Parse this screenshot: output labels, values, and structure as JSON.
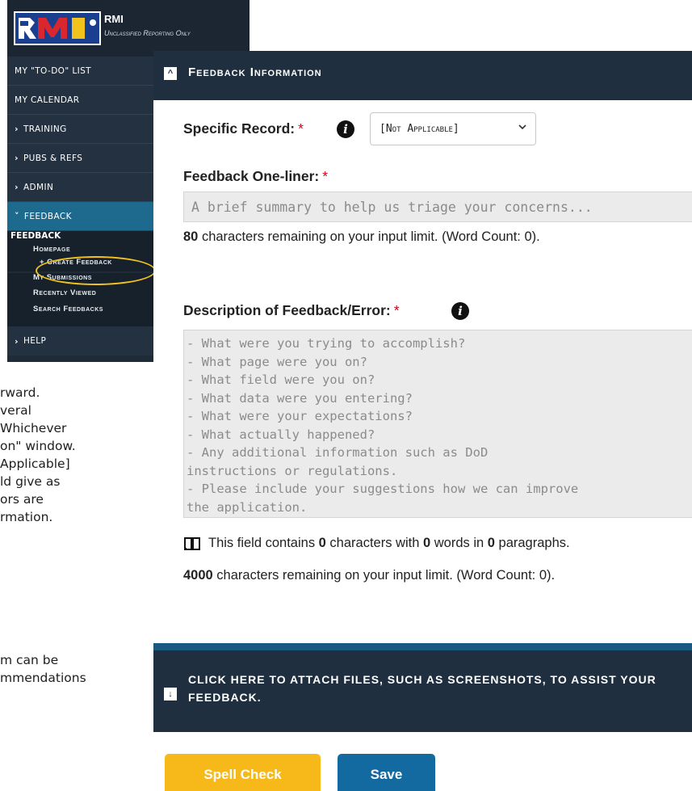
{
  "background_text": {
    "lines": [
      "rward.",
      "veral",
      "Whichever",
      "on\" window.",
      "Applicable]",
      "ld give as",
      "ors are",
      "rmation.",
      "m can be",
      "mmendations"
    ]
  },
  "nav": {
    "app_name": "RMI",
    "app_tagline": "Unclassified Reporting Only",
    "logo_text": "RMI",
    "items": [
      {
        "label": "MY \"TO-DO\" LIST",
        "chevron": ""
      },
      {
        "label": "MY CALENDAR",
        "chevron": ""
      },
      {
        "label": "TRAINING",
        "chevron": "›"
      },
      {
        "label": "PUBS & REFS",
        "chevron": "›"
      },
      {
        "label": "ADMIN",
        "chevron": "›"
      },
      {
        "label": "FEEDBACK",
        "chevron": "˅"
      }
    ],
    "sub_header": "FEEDBACK",
    "sub_items": [
      "Homepage",
      "+ Create Feedback",
      "My Submissions",
      "Recently Viewed",
      "Search Feedbacks"
    ],
    "help": {
      "label": "HELP",
      "chevron": "›"
    },
    "colors": {
      "accent_active": "#1d6a8e",
      "highlight_ring": "#f2c31c"
    }
  },
  "panel": {
    "title": "Feedback Information",
    "collapse_icon": "^",
    "specific_record": {
      "label": "Specific Record:",
      "required": "*",
      "selected": "[Not Applicable]"
    },
    "one_liner": {
      "label": "Feedback One-liner:",
      "required": "*",
      "placeholder": "A brief summary to help us triage your concerns...",
      "remaining_count": "80",
      "remaining_text": " characters remaining on your input limit. (Word Count: 0)."
    },
    "description": {
      "label": "Description of Feedback/Error:",
      "required": "*",
      "placeholder": "- What were you trying to accomplish?\n- What page were you on?\n- What field were you on?\n- What data were you entering?\n- What were your expectations?\n- What actually happened?\n- Any additional information such as DoD\ninstructions or regulations.\n- Please include your suggestions how we can improve\nthe application.",
      "stats_prefix": "This field contains ",
      "chars": "0",
      "stats_mid1": " characters with ",
      "words": "0",
      "stats_mid2": " words in ",
      "paragraphs": "0",
      "stats_suffix": " paragraphs.",
      "remaining_count": "4000",
      "remaining_text": " characters remaining on your input limit. (Word Count: 0)."
    },
    "attach": {
      "icon": "↓",
      "text": "Click here to attach files, such as screenshots, to assist your feedback."
    },
    "buttons": {
      "spell_check": "Spell Check",
      "save": "Save"
    },
    "colors": {
      "header_bg": "#1f2f3f",
      "divider": "#1b5a80",
      "spell_btn": "#f7b919",
      "save_btn": "#136aa0",
      "required": "#d0021b"
    }
  }
}
